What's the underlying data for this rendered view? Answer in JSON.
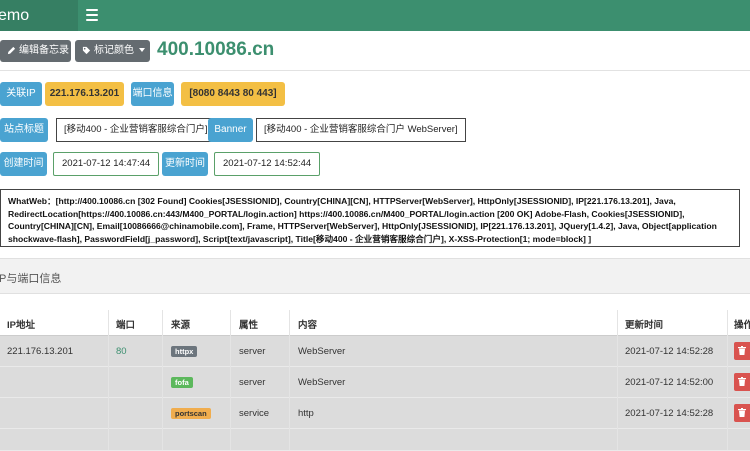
{
  "app": {
    "brand_fragment": "emo"
  },
  "toolbar": {
    "edit_memo_label": "编辑备忘录",
    "tag_color_label": "标记颜色",
    "page_title": "400.10086.cn"
  },
  "info": {
    "related_ip_label": "关联IP",
    "related_ip_value": "221.176.13.201",
    "port_info_label": "端口信息",
    "port_info_value": "[8080 8443 80 443]",
    "site_title_label": "站点标题",
    "site_title_value": "[移动400 - 企业营销客服综合门户]",
    "banner_label": "Banner",
    "banner_value": "[移动400 - 企业营销客服综合门户 WebServer]",
    "created_label": "创建时间",
    "created_value": "2021-07-12 14:47:44",
    "updated_label": "更新时间",
    "updated_value": "2021-07-12 14:52:44"
  },
  "whatweb": {
    "lines": [
      "WhatWeb：[http://400.10086.cn [302 Found] Cookies[JSESSIONID], Country[CHINA][CN], HTTPServer[WebServer], HttpOnly[JSESSIONID], IP[221.176.13.201], Java,",
      "RedirectLocation[https://400.10086.cn:443/M400_PORTAL/login.action] https://400.10086.cn/M400_PORTAL/login.action [200 OK] Adobe-Flash, Cookies[JSESSIONID],",
      "Country[CHINA][CN], Email[10086666@chinamobile.com], Frame, HTTPServer[WebServer], HttpOnly[JSESSIONID], IP[221.176.13.201], JQuery[1.4.2], Java, Object[application",
      "shockwave-flash], PasswordField[j_password], Script[text/javascript], Title[移动400 - 企业营销客服综合门户], X-XSS-Protection[1; mode=block] ]"
    ]
  },
  "section": {
    "title": "IP与端口信息"
  },
  "table": {
    "headers": [
      "IP地址",
      "端口",
      "来源",
      "属性",
      "内容",
      "更新时间",
      "操作"
    ],
    "rows": [
      {
        "ip": "221.176.13.201",
        "port": "80",
        "source": "httpx",
        "source_color": "#6c757d",
        "attr": "server",
        "content": "WebServer",
        "time": "2021-07-12 14:52:28"
      },
      {
        "ip": "",
        "port": "",
        "source": "fofa",
        "source_color": "#5cb85c",
        "attr": "server",
        "content": "WebServer",
        "time": "2021-07-12 14:52:00"
      },
      {
        "ip": "",
        "port": "",
        "source": "portscan",
        "source_color": "#f0ad4e",
        "attr": "service",
        "content": "http",
        "time": "2021-07-12 14:52:28"
      }
    ]
  },
  "colors": {
    "brand": "#3c8f6f",
    "label_blue": "#4aa3d1",
    "value_yellow": "#f3bf44",
    "delete_red": "#d9534f"
  }
}
